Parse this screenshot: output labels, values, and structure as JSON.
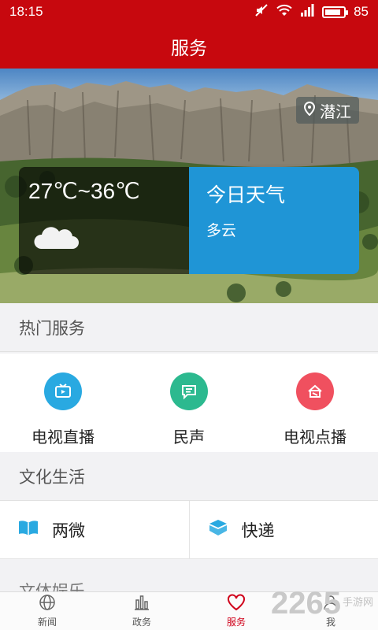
{
  "status_bar": {
    "time": "18:15",
    "battery": "85",
    "battery_level": 0.85
  },
  "header": {
    "title": "服务"
  },
  "hero": {
    "location": "潜江",
    "temperature": "27℃~36℃",
    "weather_title": "今日天气",
    "weather_desc": "多云"
  },
  "hot_services": {
    "title": "热门服务",
    "items": [
      {
        "label": "电视直播",
        "color": "#29a9e1",
        "icon": "tv-icon"
      },
      {
        "label": "民声",
        "color": "#2cb98f",
        "icon": "chat-icon"
      },
      {
        "label": "电视点播",
        "color": "#f0505f",
        "icon": "vod-icon"
      }
    ]
  },
  "culture": {
    "title": "文化生活",
    "items": [
      {
        "label": "两微",
        "icon": "book-icon",
        "color": "#29a9e1"
      },
      {
        "label": "快递",
        "icon": "box-icon",
        "color": "#29a9e1"
      }
    ]
  },
  "peek_section": {
    "title": "文体娱乐"
  },
  "bottom_nav": {
    "items": [
      {
        "label": "新闻",
        "icon": "globe-icon"
      },
      {
        "label": "政务",
        "icon": "bars-icon"
      },
      {
        "label": "服务",
        "icon": "heart-icon",
        "active": true
      },
      {
        "label": "我",
        "icon": "user-icon"
      }
    ]
  },
  "watermark": {
    "number": "2265",
    "site": "手游网"
  }
}
